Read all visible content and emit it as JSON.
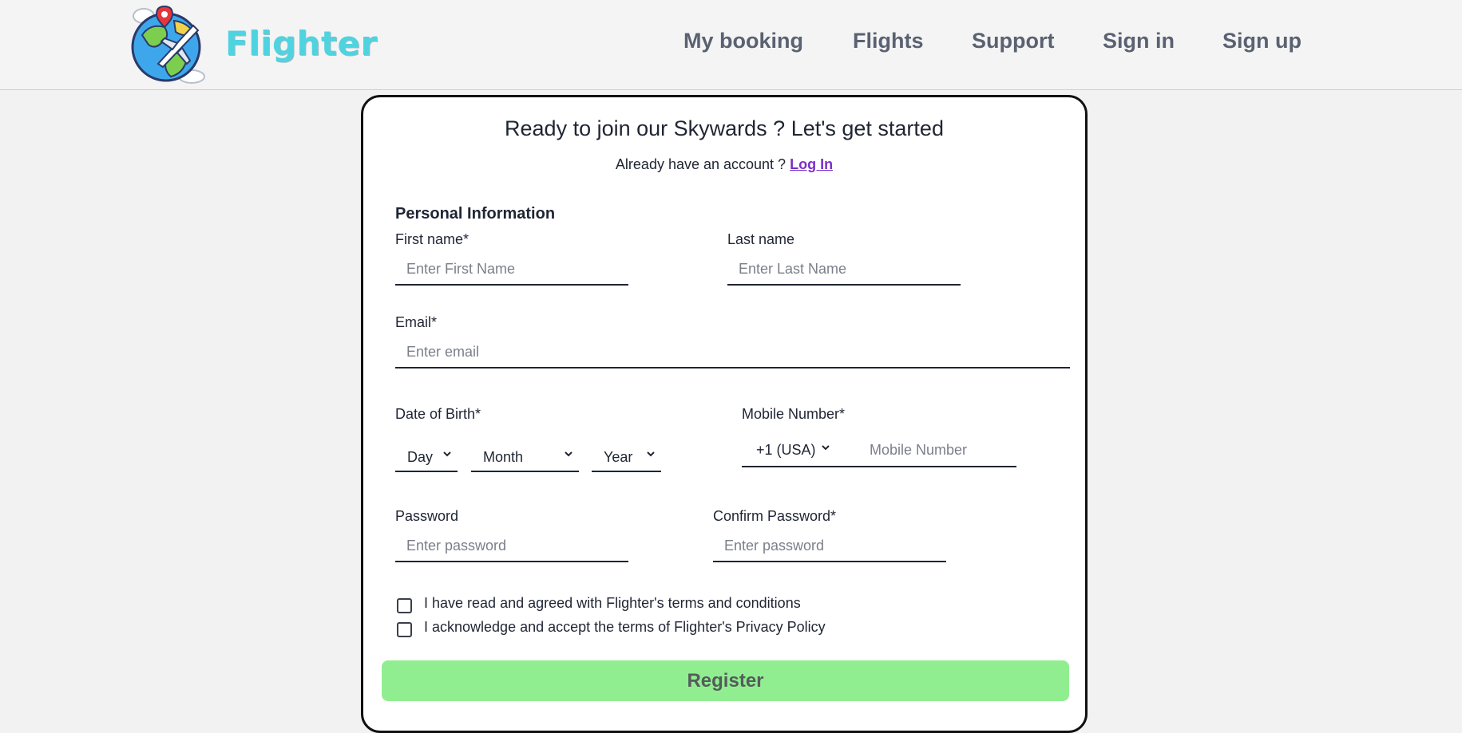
{
  "brand": {
    "name": "Flighter",
    "color": "#4fd3df"
  },
  "nav": {
    "items": [
      "My booking",
      "Flights",
      "Support",
      "Sign in",
      "Sign up"
    ]
  },
  "form": {
    "title": "Ready to join our Skywards ? Let's get started",
    "subtitle_prefix": "Already have an account ? ",
    "login_link": "Log In",
    "section_title": "Personal Information",
    "first_name": {
      "label": "First name*",
      "placeholder": "Enter First Name"
    },
    "last_name": {
      "label": "Last name",
      "placeholder": "Enter Last Name"
    },
    "email": {
      "label": "Email*",
      "placeholder": "Enter email"
    },
    "dob": {
      "label": "Date of Birth*",
      "day": "Day",
      "month": "Month",
      "year": "Year"
    },
    "mobile": {
      "label": "Mobile Number*",
      "country_code": "+1 (USA)",
      "placeholder": "Mobile Number"
    },
    "password": {
      "label": "Password",
      "placeholder": "Enter password"
    },
    "confirm_password": {
      "label": "Confirm Password*",
      "placeholder": "Enter password"
    },
    "terms": "I have read and agreed with Flighter's terms and conditions",
    "privacy": "I acknowledge and accept the terms of Flighter's Privacy Policy",
    "register_label": "Register",
    "register_color": "#90ee90",
    "link_color": "#7b2fc9"
  }
}
